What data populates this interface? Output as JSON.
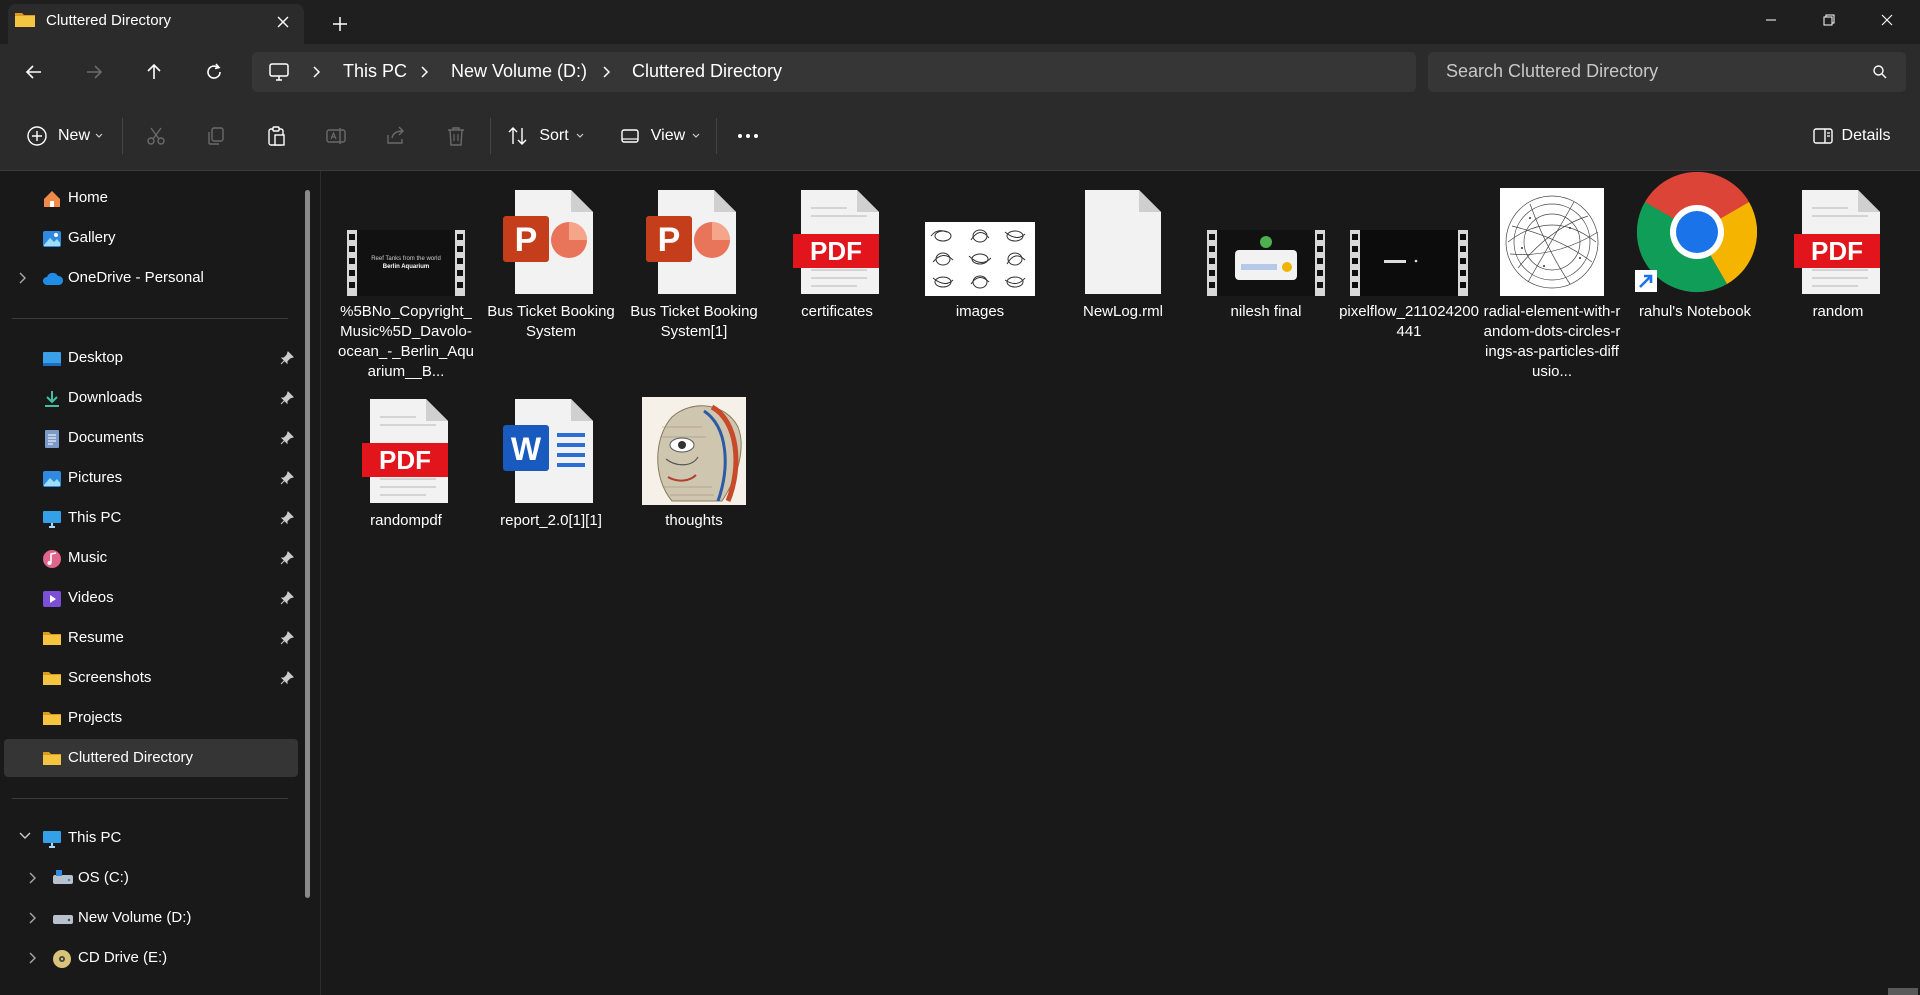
{
  "window": {
    "tab_title": "Cluttered Directory",
    "new_tab_symbol": "+"
  },
  "breadcrumb": {
    "items": [
      "This PC",
      "New Volume (D:)",
      "Cluttered Directory"
    ]
  },
  "search": {
    "placeholder": "Search Cluttered Directory"
  },
  "toolbar": {
    "new_label": "New",
    "sort_label": "Sort",
    "view_label": "View",
    "details_label": "Details"
  },
  "sidebar": {
    "top_items": [
      {
        "label": "Home",
        "icon": "home-icon"
      },
      {
        "label": "Gallery",
        "icon": "gallery-icon"
      },
      {
        "label": "OneDrive - Personal",
        "icon": "onedrive-icon"
      }
    ],
    "pinned_items": [
      {
        "label": "Desktop",
        "icon": "desktop-icon",
        "pinned": true
      },
      {
        "label": "Downloads",
        "icon": "downloads-icon",
        "pinned": true
      },
      {
        "label": "Documents",
        "icon": "documents-icon",
        "pinned": true
      },
      {
        "label": "Pictures",
        "icon": "pictures-icon",
        "pinned": true
      },
      {
        "label": "This PC",
        "icon": "pc-icon",
        "pinned": true
      },
      {
        "label": "Music",
        "icon": "music-icon",
        "pinned": true
      },
      {
        "label": "Videos",
        "icon": "videos-icon",
        "pinned": true
      },
      {
        "label": "Resume",
        "icon": "folder-icon",
        "pinned": true
      },
      {
        "label": "Screenshots",
        "icon": "folder-icon",
        "pinned": true
      },
      {
        "label": "Projects",
        "icon": "folder-icon",
        "pinned": false
      },
      {
        "label": "Cluttered Directory",
        "icon": "folder-icon",
        "pinned": false,
        "selected": true
      }
    ],
    "this_pc": {
      "label": "This PC",
      "drives": [
        {
          "label": "OS (C:)",
          "icon": "drive-icon"
        },
        {
          "label": "New Volume (D:)",
          "icon": "drive-icon"
        },
        {
          "label": "CD Drive (E:)",
          "icon": "cd-drive-icon"
        }
      ]
    }
  },
  "files": [
    {
      "name": "%5BNo_Copyright_Music%5D_Davolo-ocean_-_Berlin_Aquarium__B...",
      "type": "video",
      "video_text_1": "Reef Tanks from the world",
      "video_text_2": "Berlin Aquarium"
    },
    {
      "name": "Bus Ticket Booking System",
      "type": "pptx",
      "badge": "P"
    },
    {
      "name": "Bus Ticket Booking System[1]",
      "type": "pptx",
      "badge": "P"
    },
    {
      "name": "certificates",
      "type": "pdf",
      "badge": "PDF"
    },
    {
      "name": "images",
      "type": "image-sketches"
    },
    {
      "name": "NewLog.rml",
      "type": "generic"
    },
    {
      "name": "nilesh final",
      "type": "video-app"
    },
    {
      "name": "pixelflow_211024200441",
      "type": "video-dark"
    },
    {
      "name": "radial-element-with-random-dots-circles-rings-as-particles-diffusio...",
      "type": "image-radial"
    },
    {
      "name": "rahul's Notebook",
      "type": "shortcut-chrome"
    },
    {
      "name": "random",
      "type": "pdf",
      "badge": "PDF"
    },
    {
      "name": "randompdf",
      "type": "pdf",
      "badge": "PDF"
    },
    {
      "name": "report_2.0[1][1]",
      "type": "docx",
      "badge": "W"
    },
    {
      "name": "thoughts",
      "type": "image-art"
    }
  ],
  "colors": {
    "pdf_red": "#e2141c",
    "ppt_orange": "#c43e1c",
    "word_blue": "#185abd",
    "folder_yellow": "#f5c542"
  }
}
